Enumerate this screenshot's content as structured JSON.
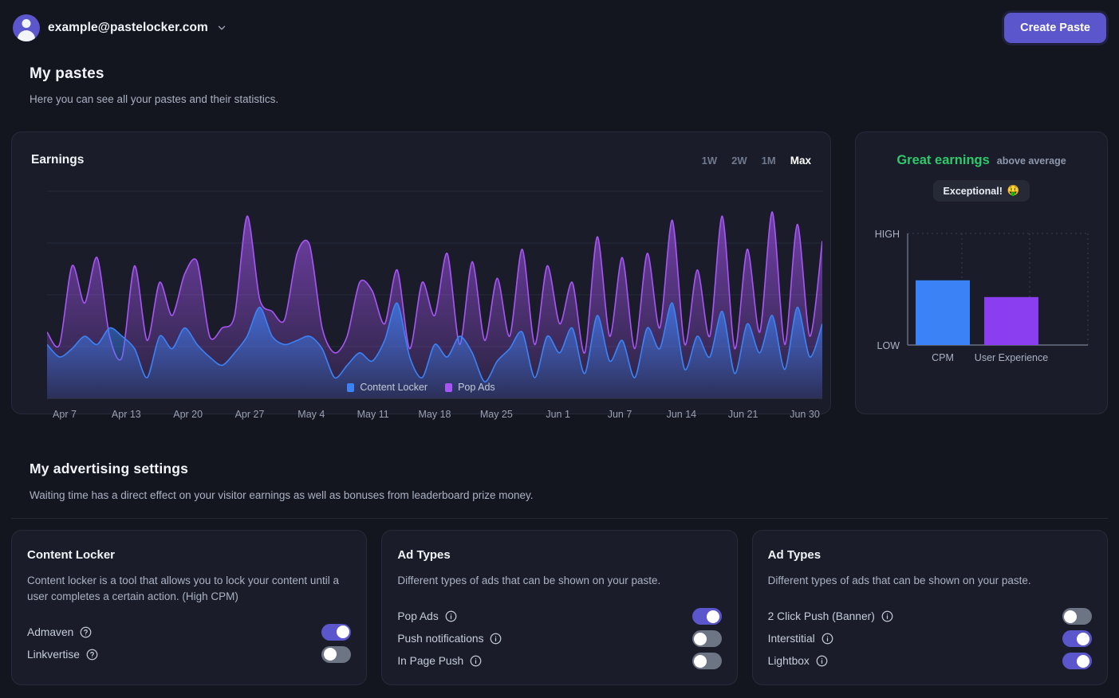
{
  "topbar": {
    "account_email": "example@pastelocker.com",
    "chevron_icon": "chevron-down-icon",
    "avatar_icon": "user-avatar-icon",
    "create_paste_label": "Create Paste",
    "accent_color": "#5c56cc"
  },
  "heading": {
    "title": "My pastes",
    "subtitle": "Here you can see all your pastes and their statistics."
  },
  "earnings": {
    "title": "Earnings",
    "ranges": [
      {
        "label": "1W",
        "active": false
      },
      {
        "label": "2W",
        "active": false
      },
      {
        "label": "1M",
        "active": false
      },
      {
        "label": "Max",
        "active": true
      }
    ],
    "legend": [
      {
        "label": "Content Locker",
        "color": "#3b82f6"
      },
      {
        "label": "Pop Ads",
        "color": "#a855f7"
      }
    ]
  },
  "great_earnings": {
    "title": "Great earnings",
    "title_color": "#2fc96b",
    "subtitle": "above average",
    "badge_label": "Exceptional!",
    "badge_emoji": "🤑"
  },
  "advertising": {
    "title": "My advertising settings",
    "subtitle": "Waiting time has a direct effect on your visitor earnings as well as bonuses from leaderboard prize money."
  },
  "setting_cards": [
    {
      "title": "Content Locker",
      "description": "Content locker is a tool that allows you to lock your content until a user completes a certain action. (High CPM)",
      "icon_type": "help-circle-icon",
      "options": [
        {
          "label": "Admaven",
          "on": true
        },
        {
          "label": "Linkvertise",
          "on": false
        }
      ]
    },
    {
      "title": "Ad Types",
      "description": "Different types of ads that can be shown on your paste.",
      "icon_type": "info-circle-icon",
      "options": [
        {
          "label": "Pop Ads",
          "on": true
        },
        {
          "label": "Push notifications",
          "on": false
        },
        {
          "label": "In Page Push",
          "on": false
        }
      ]
    },
    {
      "title": "Ad Types",
      "description": "Different types of ads that can be shown on your paste.",
      "icon_type": "info-circle-icon",
      "options": [
        {
          "label": "2 Click Push (Banner)",
          "on": false
        },
        {
          "label": "Interstitial",
          "on": true
        },
        {
          "label": "Lightbox",
          "on": true
        }
      ]
    }
  ],
  "chart_data": [
    {
      "id": "earnings_area",
      "type": "area",
      "title": "Earnings",
      "xlabel": "",
      "ylabel": "",
      "grid": true,
      "legend_position": "bottom",
      "ylim": [
        0,
        100
      ],
      "tick_labels": [
        "Apr 7",
        "Apr 13",
        "Apr 20",
        "Apr 27",
        "May 4",
        "May 11",
        "May 18",
        "May 25",
        "Jun 1",
        "Jun 7",
        "Jun 14",
        "Jun 21",
        "Jun 30"
      ],
      "series": [
        {
          "name": "Content Locker",
          "color": "#3b82f6",
          "values": [
            26,
            20,
            24,
            30,
            26,
            34,
            30,
            24,
            10,
            30,
            24,
            34,
            26,
            20,
            16,
            22,
            30,
            44,
            30,
            26,
            28,
            30,
            24,
            10,
            16,
            22,
            18,
            28,
            46,
            20,
            10,
            26,
            20,
            30,
            22,
            8,
            18,
            24,
            32,
            10,
            30,
            22,
            34,
            12,
            40,
            18,
            28,
            10,
            34,
            24,
            46,
            14,
            30,
            20,
            42,
            12,
            36,
            22,
            40,
            14,
            44,
            20,
            36
          ]
        },
        {
          "name": "Pop Ads",
          "color": "#a855f7",
          "values": [
            32,
            26,
            64,
            46,
            68,
            30,
            20,
            64,
            28,
            56,
            40,
            60,
            66,
            30,
            34,
            40,
            88,
            48,
            42,
            38,
            70,
            74,
            34,
            22,
            30,
            56,
            52,
            36,
            62,
            24,
            56,
            40,
            70,
            26,
            66,
            28,
            58,
            30,
            72,
            26,
            64,
            36,
            56,
            22,
            78,
            30,
            68,
            24,
            70,
            34,
            86,
            26,
            62,
            30,
            88,
            24,
            72,
            32,
            90,
            26,
            84,
            30,
            76
          ]
        }
      ]
    },
    {
      "id": "performance_bars",
      "type": "bar",
      "categories": [
        "CPM",
        "User Experience"
      ],
      "values": [
        58,
        43
      ],
      "colors": [
        "#3b82f6",
        "#8b3df0"
      ],
      "ylim": [
        0,
        100
      ],
      "y_tick_labels": [
        "HIGH",
        "LOW"
      ],
      "grid": true,
      "title": "",
      "xlabel": "",
      "ylabel": ""
    }
  ]
}
